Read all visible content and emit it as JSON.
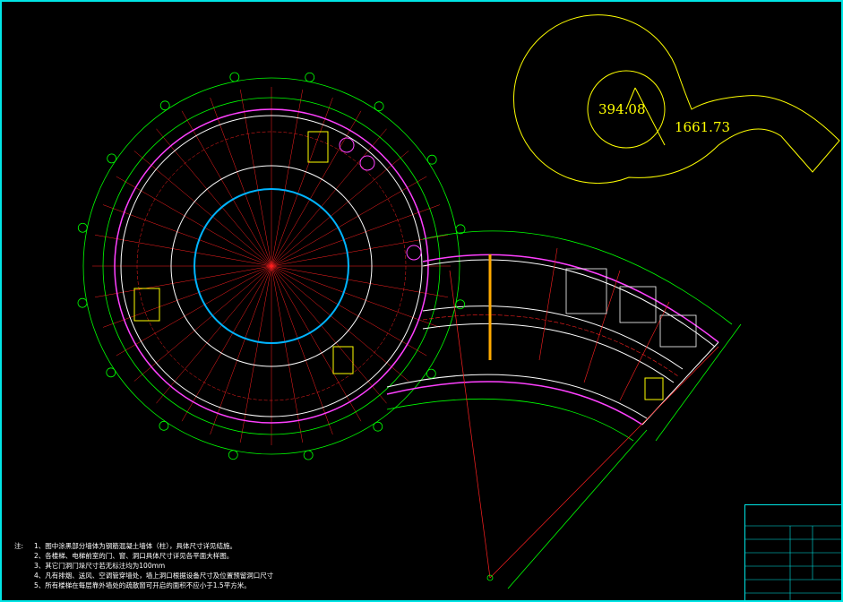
{
  "drawing": {
    "area_label_inner": "394.08",
    "area_label_outer": "1661.73",
    "plan_title": "",
    "plan_subtitle": "",
    "sector_title": "",
    "title_block_company": ""
  },
  "notes": {
    "heading": "注:",
    "items": [
      {
        "n": "1、",
        "text": "图中涂黑部分墙体为钢筋混凝土墙体（柱），具体尺寸详见结施。"
      },
      {
        "n": "2、",
        "text": "各楼梯、电梯前室的门、窗、洞口具体尺寸详见各平面大样图。"
      },
      {
        "n": "3、",
        "text": "其它门洞门垛尺寸若无标注均为100mm"
      },
      {
        "n": "4、",
        "text": "凡有排烟、送风、空调管穿墙处，墙上洞口根据设备尺寸及位置预留洞口尺寸"
      },
      {
        "n": "5、",
        "text": "所有楼梯在每层靠外墙处的疏散窗可开启的面积不应小于1.5平方米。"
      }
    ]
  },
  "colors": {
    "frame": "#00e5e5",
    "wall": "#00ff00",
    "axis": "#ff2020",
    "finish": "#ff40ff",
    "ring": "#00b4ff",
    "annotation": "#ffff00",
    "room": "#ffffff"
  }
}
